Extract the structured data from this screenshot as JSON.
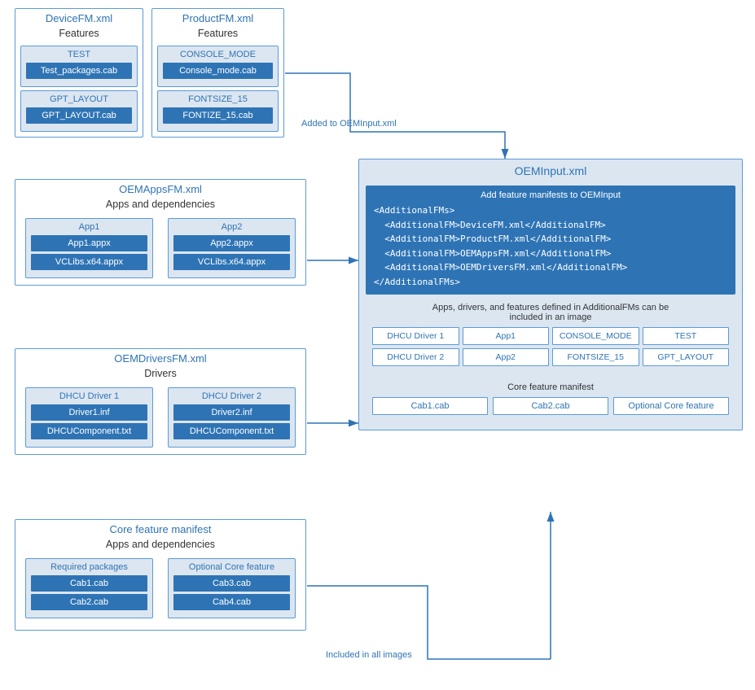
{
  "deviceFM": {
    "title": "DeviceFM.xml",
    "subtitle": "Features",
    "features": [
      {
        "label": "TEST",
        "pkg": "Test_packages.cab"
      },
      {
        "label": "GPT_LAYOUT",
        "pkg": "GPT_LAYOUT.cab"
      }
    ]
  },
  "productFM": {
    "title": "ProductFM.xml",
    "subtitle": "Features",
    "features": [
      {
        "label": "CONSOLE_MODE",
        "pkg": "Console_mode.cab"
      },
      {
        "label": "FONTSIZE_15",
        "pkg": "FONTIZE_15.cab"
      }
    ]
  },
  "oemAppsFM": {
    "title": "OEMAppsFM.xml",
    "subtitle": "Apps and dependencies",
    "app1": {
      "label": "App1",
      "items": [
        "App1.appx",
        "VCLibs.x64.appx"
      ]
    },
    "app2": {
      "label": "App2",
      "items": [
        "App2.appx",
        "VCLibs.x64.appx"
      ]
    }
  },
  "oemDriversFM": {
    "title": "OEMDriversFM.xml",
    "subtitle": "Drivers",
    "driver1": {
      "label": "DHCU Driver 1",
      "items": [
        "Driver1.inf",
        "DHCUComponent.txt"
      ]
    },
    "driver2": {
      "label": "DHCU Driver 2",
      "items": [
        "Driver2.inf",
        "DHCUComponent.txt"
      ]
    }
  },
  "coreFeature": {
    "title": "Core feature manifest",
    "subtitle": "Apps and dependencies",
    "required": {
      "label": "Required packages",
      "items": [
        "Cab1.cab",
        "Cab2.cab"
      ]
    },
    "optional": {
      "label": "Optional Core feature",
      "items": [
        "Cab3.cab",
        "Cab4.cab"
      ]
    }
  },
  "oemInput": {
    "title": "OEMInput.xml",
    "xmlSection": {
      "title": "Add feature manifests to OEMInput",
      "code": "<AdditionalFMs>\n  <AdditionalFM>DeviceFM.xml</AdditionalFM>\n  <AdditionalFM>ProductFM.xml</AdditionalFM>\n  <AdditionalFM>OEMAppsFM.xml</AdditionalFM>\n  <AdditionalFM>OEMDriversFM.xml</AdditionalFM>\n</AdditionalFMs>"
    },
    "driversSection": {
      "title": "Apps, drivers, and features defined in AdditionalFMs can be\nincluded in an image",
      "row1": [
        "DHCU Driver 1",
        "App1",
        "CONSOLE_MODE",
        "TEST"
      ],
      "row2": [
        "DHCU Driver 2",
        "App2",
        "FONTSIZE_15",
        "GPT_LAYOUT"
      ]
    },
    "coreSection": {
      "title": "Core feature manifest",
      "items": [
        "Cab1.cab",
        "Cab2.cab",
        "Optional Core feature"
      ]
    }
  },
  "arrows": {
    "addedToOEM": "Added to OEMInput.xml",
    "includedInAll": "Included in all images"
  }
}
